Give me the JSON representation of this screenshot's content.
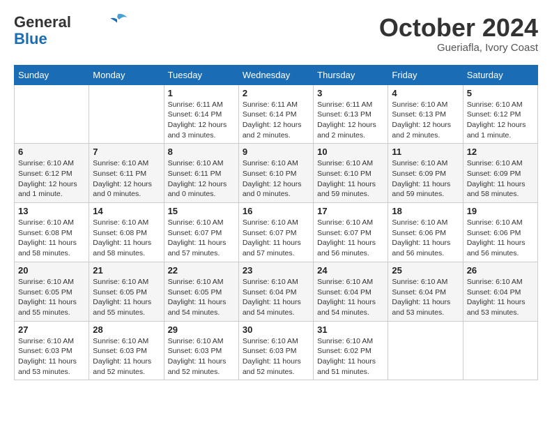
{
  "header": {
    "logo_line1": "General",
    "logo_line2": "Blue",
    "month_title": "October 2024",
    "location": "Gueriafla, Ivory Coast"
  },
  "weekdays": [
    "Sunday",
    "Monday",
    "Tuesday",
    "Wednesday",
    "Thursday",
    "Friday",
    "Saturday"
  ],
  "weeks": [
    [
      {
        "day": "",
        "info": ""
      },
      {
        "day": "",
        "info": ""
      },
      {
        "day": "1",
        "info": "Sunrise: 6:11 AM\nSunset: 6:14 PM\nDaylight: 12 hours\nand 3 minutes."
      },
      {
        "day": "2",
        "info": "Sunrise: 6:11 AM\nSunset: 6:14 PM\nDaylight: 12 hours\nand 2 minutes."
      },
      {
        "day": "3",
        "info": "Sunrise: 6:11 AM\nSunset: 6:13 PM\nDaylight: 12 hours\nand 2 minutes."
      },
      {
        "day": "4",
        "info": "Sunrise: 6:10 AM\nSunset: 6:13 PM\nDaylight: 12 hours\nand 2 minutes."
      },
      {
        "day": "5",
        "info": "Sunrise: 6:10 AM\nSunset: 6:12 PM\nDaylight: 12 hours\nand 1 minute."
      }
    ],
    [
      {
        "day": "6",
        "info": "Sunrise: 6:10 AM\nSunset: 6:12 PM\nDaylight: 12 hours\nand 1 minute."
      },
      {
        "day": "7",
        "info": "Sunrise: 6:10 AM\nSunset: 6:11 PM\nDaylight: 12 hours\nand 0 minutes."
      },
      {
        "day": "8",
        "info": "Sunrise: 6:10 AM\nSunset: 6:11 PM\nDaylight: 12 hours\nand 0 minutes."
      },
      {
        "day": "9",
        "info": "Sunrise: 6:10 AM\nSunset: 6:10 PM\nDaylight: 12 hours\nand 0 minutes."
      },
      {
        "day": "10",
        "info": "Sunrise: 6:10 AM\nSunset: 6:10 PM\nDaylight: 11 hours\nand 59 minutes."
      },
      {
        "day": "11",
        "info": "Sunrise: 6:10 AM\nSunset: 6:09 PM\nDaylight: 11 hours\nand 59 minutes."
      },
      {
        "day": "12",
        "info": "Sunrise: 6:10 AM\nSunset: 6:09 PM\nDaylight: 11 hours\nand 58 minutes."
      }
    ],
    [
      {
        "day": "13",
        "info": "Sunrise: 6:10 AM\nSunset: 6:08 PM\nDaylight: 11 hours\nand 58 minutes."
      },
      {
        "day": "14",
        "info": "Sunrise: 6:10 AM\nSunset: 6:08 PM\nDaylight: 11 hours\nand 58 minutes."
      },
      {
        "day": "15",
        "info": "Sunrise: 6:10 AM\nSunset: 6:07 PM\nDaylight: 11 hours\nand 57 minutes."
      },
      {
        "day": "16",
        "info": "Sunrise: 6:10 AM\nSunset: 6:07 PM\nDaylight: 11 hours\nand 57 minutes."
      },
      {
        "day": "17",
        "info": "Sunrise: 6:10 AM\nSunset: 6:07 PM\nDaylight: 11 hours\nand 56 minutes."
      },
      {
        "day": "18",
        "info": "Sunrise: 6:10 AM\nSunset: 6:06 PM\nDaylight: 11 hours\nand 56 minutes."
      },
      {
        "day": "19",
        "info": "Sunrise: 6:10 AM\nSunset: 6:06 PM\nDaylight: 11 hours\nand 56 minutes."
      }
    ],
    [
      {
        "day": "20",
        "info": "Sunrise: 6:10 AM\nSunset: 6:05 PM\nDaylight: 11 hours\nand 55 minutes."
      },
      {
        "day": "21",
        "info": "Sunrise: 6:10 AM\nSunset: 6:05 PM\nDaylight: 11 hours\nand 55 minutes."
      },
      {
        "day": "22",
        "info": "Sunrise: 6:10 AM\nSunset: 6:05 PM\nDaylight: 11 hours\nand 54 minutes."
      },
      {
        "day": "23",
        "info": "Sunrise: 6:10 AM\nSunset: 6:04 PM\nDaylight: 11 hours\nand 54 minutes."
      },
      {
        "day": "24",
        "info": "Sunrise: 6:10 AM\nSunset: 6:04 PM\nDaylight: 11 hours\nand 54 minutes."
      },
      {
        "day": "25",
        "info": "Sunrise: 6:10 AM\nSunset: 6:04 PM\nDaylight: 11 hours\nand 53 minutes."
      },
      {
        "day": "26",
        "info": "Sunrise: 6:10 AM\nSunset: 6:04 PM\nDaylight: 11 hours\nand 53 minutes."
      }
    ],
    [
      {
        "day": "27",
        "info": "Sunrise: 6:10 AM\nSunset: 6:03 PM\nDaylight: 11 hours\nand 53 minutes."
      },
      {
        "day": "28",
        "info": "Sunrise: 6:10 AM\nSunset: 6:03 PM\nDaylight: 11 hours\nand 52 minutes."
      },
      {
        "day": "29",
        "info": "Sunrise: 6:10 AM\nSunset: 6:03 PM\nDaylight: 11 hours\nand 52 minutes."
      },
      {
        "day": "30",
        "info": "Sunrise: 6:10 AM\nSunset: 6:03 PM\nDaylight: 11 hours\nand 52 minutes."
      },
      {
        "day": "31",
        "info": "Sunrise: 6:10 AM\nSunset: 6:02 PM\nDaylight: 11 hours\nand 51 minutes."
      },
      {
        "day": "",
        "info": ""
      },
      {
        "day": "",
        "info": ""
      }
    ]
  ]
}
